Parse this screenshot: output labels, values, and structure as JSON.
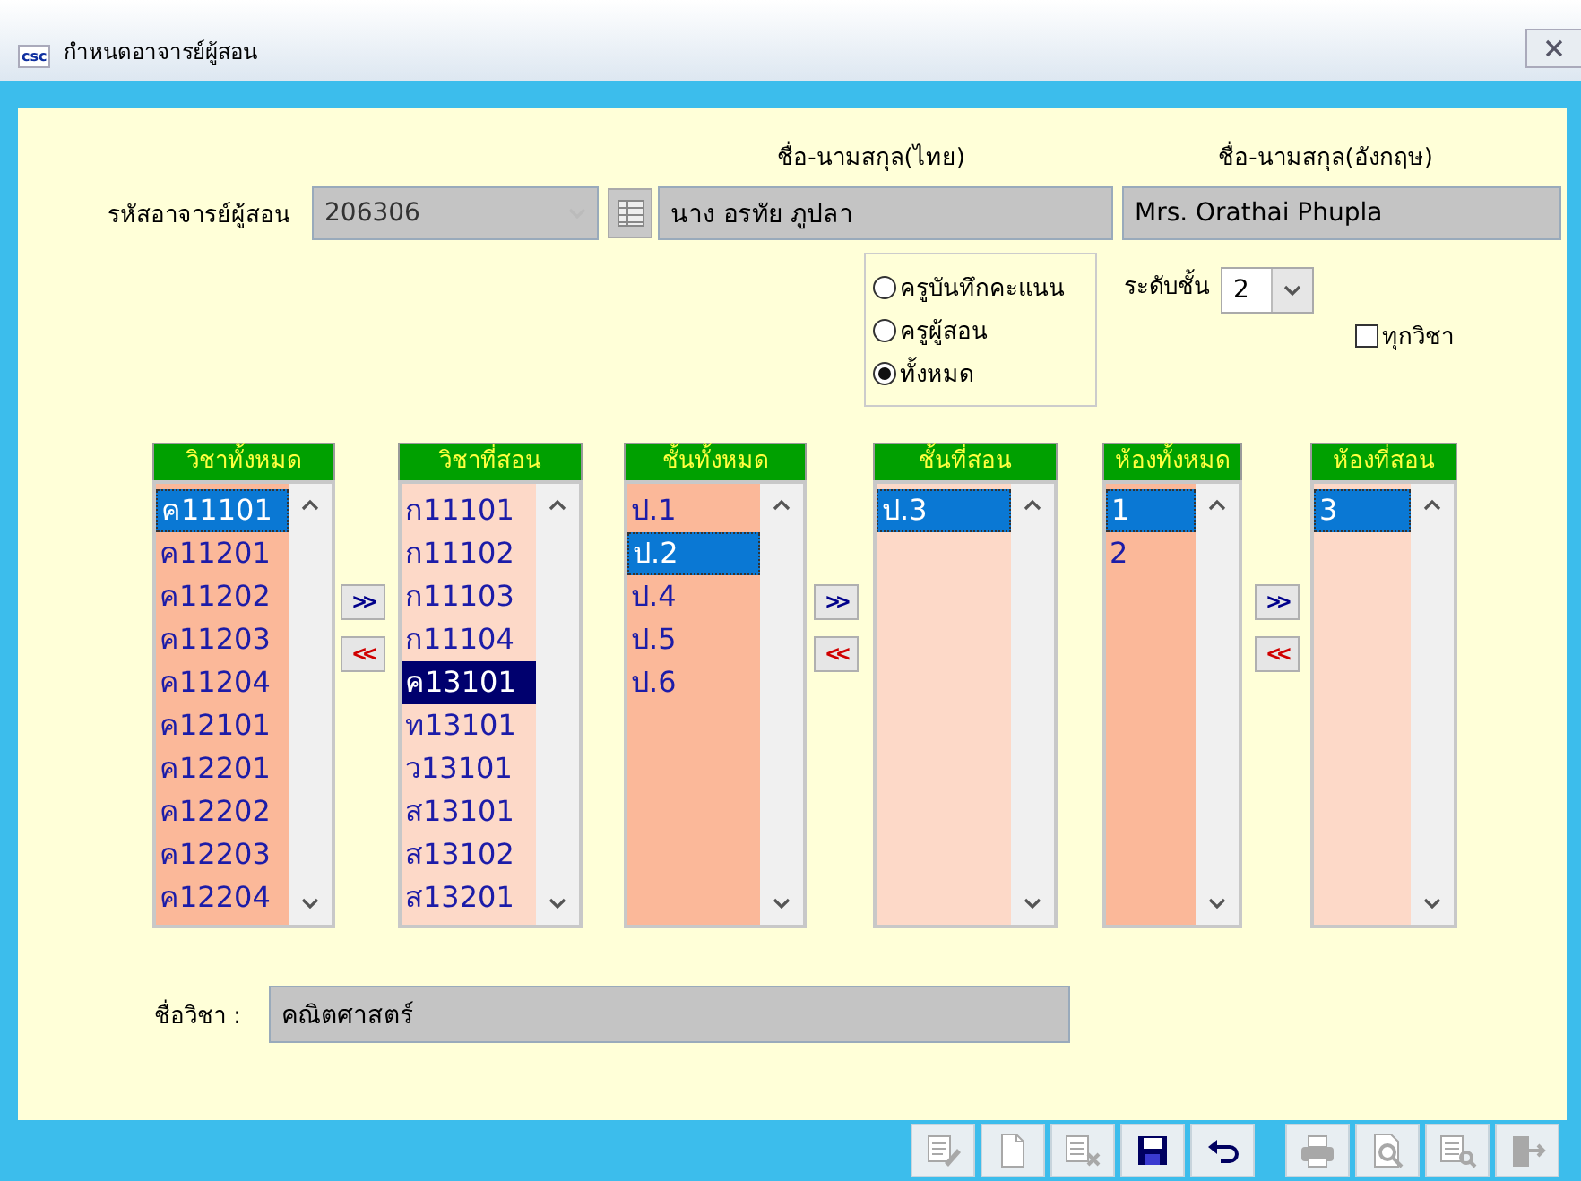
{
  "window": {
    "title": "กำหนดอาจารย์ผู้สอน",
    "app_icon": "csc"
  },
  "teacher": {
    "label": "รหัสอาจารย์ผู้สอน",
    "code": "206306",
    "code_disabled": true,
    "thai_name_heading": "ชื่อ-นามสกุล(ไทย)",
    "thai_name": "นาง อรทัย ภูปลา",
    "english_name_heading": "ชื่อ-นามสกุล(อังกฤษ)",
    "english_name": "Mrs. Orathai Phupla"
  },
  "roles": [
    {
      "label": "ครูบันทึกคะแนน",
      "selected": false
    },
    {
      "label": "ครูผู้สอน",
      "selected": false
    },
    {
      "label": "ทั้งหมด",
      "selected": true
    }
  ],
  "level": {
    "label": "ระดับชั้น",
    "value": "2"
  },
  "all_subjects": {
    "label": "ทุกวิชา",
    "checked": false
  },
  "lists": [
    {
      "title": "วิชาทั้งหมด",
      "kind": "source",
      "focused": false,
      "items": [
        {
          "text": "ค11101",
          "selected": true
        },
        {
          "text": "ค11201",
          "selected": false
        },
        {
          "text": "ค11202",
          "selected": false
        },
        {
          "text": "ค11203",
          "selected": false
        },
        {
          "text": "ค11204",
          "selected": false
        },
        {
          "text": "ค12101",
          "selected": false
        },
        {
          "text": "ค12201",
          "selected": false
        },
        {
          "text": "ค12202",
          "selected": false
        },
        {
          "text": "ค12203",
          "selected": false
        },
        {
          "text": "ค12204",
          "selected": false
        }
      ]
    },
    {
      "title": "วิชาที่สอน",
      "kind": "target",
      "focused": true,
      "items": [
        {
          "text": "ก11101",
          "selected": false
        },
        {
          "text": "ก11102",
          "selected": false
        },
        {
          "text": "ก11103",
          "selected": false
        },
        {
          "text": "ก11104",
          "selected": false
        },
        {
          "text": "ค13101",
          "selected": true
        },
        {
          "text": "ท13101",
          "selected": false
        },
        {
          "text": "ว13101",
          "selected": false
        },
        {
          "text": "ส13101",
          "selected": false
        },
        {
          "text": "ส13102",
          "selected": false
        },
        {
          "text": "ส13201",
          "selected": false
        }
      ]
    },
    {
      "title": "ชั้นทั้งหมด",
      "kind": "source",
      "focused": false,
      "items": [
        {
          "text": "ป.1",
          "selected": false
        },
        {
          "text": "ป.2",
          "selected": true
        },
        {
          "text": "ป.4",
          "selected": false
        },
        {
          "text": "ป.5",
          "selected": false
        },
        {
          "text": "ป.6",
          "selected": false
        }
      ]
    },
    {
      "title": "ชั้นที่สอน",
      "kind": "target",
      "focused": false,
      "items": [
        {
          "text": "ป.3",
          "selected": true
        }
      ]
    },
    {
      "title": "ห้องทั้งหมด",
      "kind": "source",
      "focused": false,
      "items": [
        {
          "text": "1",
          "selected": true
        },
        {
          "text": "2",
          "selected": false
        }
      ]
    },
    {
      "title": "ห้องที่สอน",
      "kind": "target",
      "focused": false,
      "items": [
        {
          "text": "3",
          "selected": true
        }
      ]
    }
  ],
  "transfers": [
    {
      "add": ">>",
      "remove": "<<"
    },
    {
      "add": ">>",
      "remove": "<<"
    },
    {
      "add": ">>",
      "remove": "<<"
    }
  ],
  "subject_name": {
    "label": "ชื่อวิชา :",
    "value": "คณิตศาสตร์"
  },
  "toolbar": [
    {
      "kind": "edit",
      "disabled": true
    },
    {
      "kind": "new",
      "disabled": true
    },
    {
      "kind": "delete",
      "disabled": true
    },
    {
      "kind": "save",
      "disabled": false
    },
    {
      "kind": "undo",
      "disabled": false
    },
    {
      "kind": "print",
      "disabled": true
    },
    {
      "kind": "preview",
      "disabled": true
    },
    {
      "kind": "search",
      "disabled": true
    },
    {
      "kind": "exit",
      "disabled": true
    }
  ]
}
